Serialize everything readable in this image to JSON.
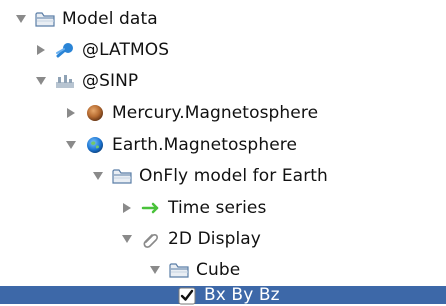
{
  "tree": {
    "root_label": "Model data",
    "items": [
      {
        "label": "Model data",
        "icon": "folder-icon",
        "expanded": true
      },
      {
        "label": "@LATMOS",
        "icon": "comet-icon",
        "expanded": false
      },
      {
        "label": "@SINP",
        "icon": "factory-icon",
        "expanded": true
      },
      {
        "label": "Mercury.Magnetosphere",
        "icon": "planet-mercury-icon",
        "expanded": false
      },
      {
        "label": "Earth.Magnetosphere",
        "icon": "planet-earth-icon",
        "expanded": true
      },
      {
        "label": "OnFly model for Earth",
        "icon": "folder-icon",
        "expanded": true
      },
      {
        "label": "Time series",
        "icon": "arrow-right-icon",
        "expanded": false
      },
      {
        "label": "2D Display",
        "icon": "paperclip-icon",
        "expanded": true
      },
      {
        "label": "Cube",
        "icon": "folder-icon",
        "expanded": true
      },
      {
        "label": "Bx By Bz",
        "icon": "checkbox-icon",
        "checked": true,
        "selected": true
      }
    ]
  },
  "colors": {
    "selection": "#3d68a8",
    "folder": "#5b7ea6",
    "arrow": "#8a8a8a",
    "green_arrow": "#49c23a"
  }
}
